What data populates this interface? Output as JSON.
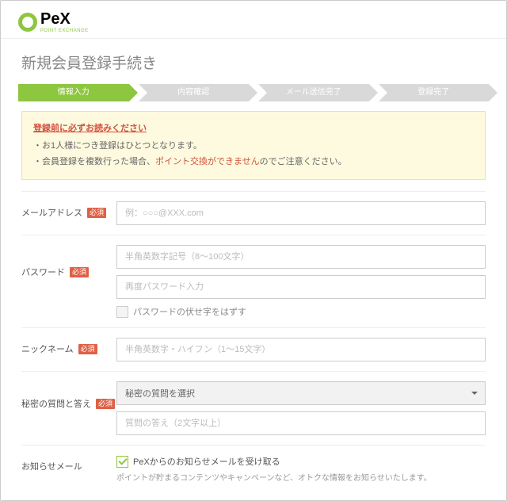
{
  "header": {
    "brand_name": "PeX",
    "brand_sub": "POINT EXCHANGE"
  },
  "page_title": "新規会員登録手続き",
  "steps": [
    "情報入力",
    "内容確認",
    "メール送信完了",
    "登録完了"
  ],
  "notice": {
    "title": "登録前に必ずお読みください",
    "line1": "・お1人様につき登録はひとつとなります。",
    "line2_a": "・会員登録を複数行った場合、",
    "line2_warn": "ポイント交換ができません",
    "line2_b": "のでご注意ください。"
  },
  "labels": {
    "required": "必須",
    "email": "メールアドレス",
    "password": "パスワード",
    "nickname": "ニックネーム",
    "secret": "秘密の質問と答え",
    "newsletter": "お知らせメール"
  },
  "placeholders": {
    "email": "例：○○○@XXX.com",
    "password": "半角英数字記号（8～100文字）",
    "password_confirm": "再度パスワード入力",
    "nickname": "半角英数字・ハイフン（1～15文字）",
    "secret_answer": "質問の答え（2文字以上）"
  },
  "values": {
    "secret_select": "秘密の質問を選択"
  },
  "checkbox": {
    "password_show": "パスワードの伏せ字をはずす",
    "newsletter": "PeXからのお知らせメールを受け取る"
  },
  "hints": {
    "newsletter": "ポイントが貯まるコンテンツやキャンペーンなど、オトクな情報をお知らせいたします。"
  }
}
